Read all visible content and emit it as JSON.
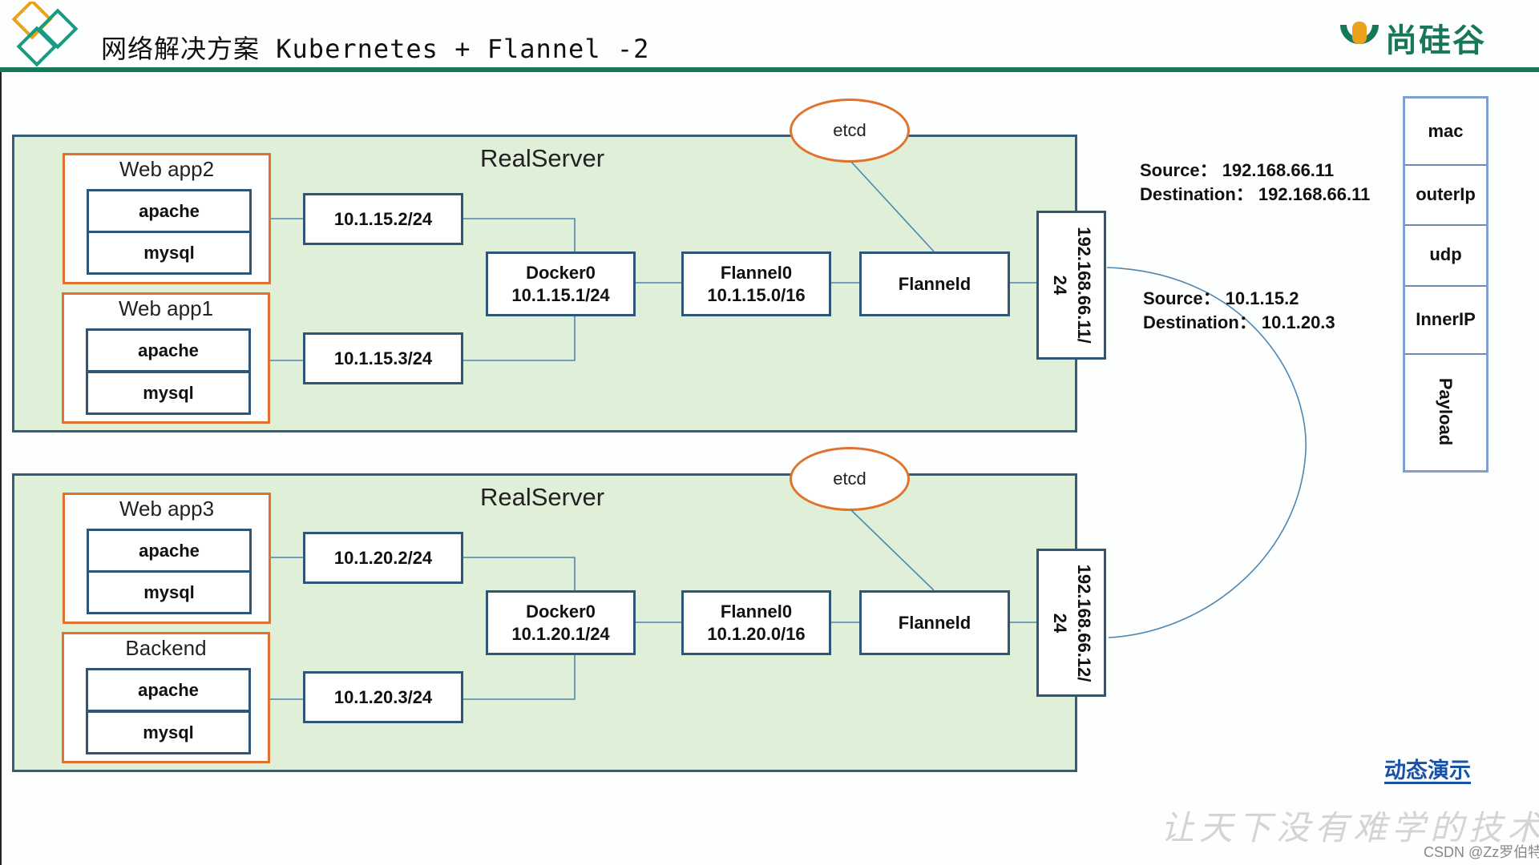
{
  "header": {
    "title": "网络解决方案 Kubernetes + Flannel -2",
    "brand": "尚硅谷",
    "brand_mark": "U",
    "colors": {
      "accent": "#17775a",
      "logo_orange": "#e8a21c",
      "logo_green": "#1a9a82"
    }
  },
  "servers": [
    {
      "label": "RealServer",
      "etcd": "etcd",
      "apps": [
        {
          "title": "Web app2",
          "services": [
            "apache",
            "mysql"
          ],
          "ip": "10.1.15.2/24"
        },
        {
          "title": "Web app1",
          "services": [
            "apache",
            "mysql"
          ],
          "ip": "10.1.15.3/24"
        }
      ],
      "docker0": {
        "name": "Docker0",
        "ip": "10.1.15.1/24"
      },
      "flannel0": {
        "name": "Flannel0",
        "ip": "10.1.15.0/16"
      },
      "flanneld": "Flanneld",
      "nic": {
        "line1": "192.168.66.11/",
        "line2": "24"
      }
    },
    {
      "label": "RealServer",
      "etcd": "etcd",
      "apps": [
        {
          "title": "Web app3",
          "services": [
            "apache",
            "mysql"
          ],
          "ip": "10.1.20.2/24"
        },
        {
          "title": "Backend",
          "services": [
            "apache",
            "mysql"
          ],
          "ip": "10.1.20.3/24"
        }
      ],
      "docker0": {
        "name": "Docker0",
        "ip": "10.1.20.1/24"
      },
      "flannel0": {
        "name": "Flannel0",
        "ip": "10.1.20.0/16"
      },
      "flanneld": "Flanneld",
      "nic": {
        "line1": "192.168.66.12/",
        "line2": "24"
      }
    }
  ],
  "outer_header": {
    "source": "Source：  192.168.66.11",
    "destination": "Destination：  192.168.66.11"
  },
  "inner_header": {
    "source": "Source：  10.1.15.2",
    "destination": "Destination：  10.1.20.3"
  },
  "packet": [
    "mac",
    "outerIp",
    "udp",
    "InnerIP",
    "Payload"
  ],
  "demo_link": "动态演示",
  "slogan": "让天下没有难学的技术",
  "watermark": "CSDN @Zz罗伯特",
  "colors": {
    "server_fill": "#e0efd8",
    "server_border": "#385b7a",
    "app_border": "#e0732b",
    "line": "#4e86b0",
    "link": "#1a52a8"
  }
}
